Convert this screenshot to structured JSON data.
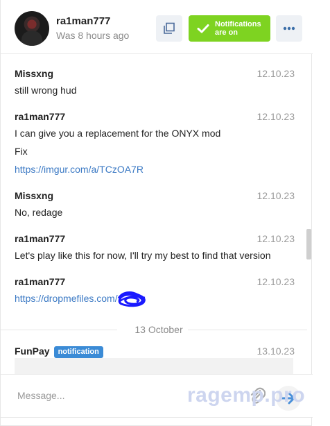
{
  "header": {
    "username": "ra1man777",
    "last_seen": "Was 8 hours ago",
    "notifications_label": "Notifications are on"
  },
  "messages": [
    {
      "author": "Missxng",
      "date": "12.10.23",
      "lines": [
        "still wrong hud"
      ]
    },
    {
      "author": "ra1man777",
      "date": "12.10.23",
      "lines": [
        "I can give you a replacement for the ONYX mod",
        "Fix"
      ],
      "link": "https://imgur.com/a/TCzOA7R"
    },
    {
      "author": "Missxng",
      "date": "12.10.23",
      "lines": [
        "No, redage"
      ]
    },
    {
      "author": "ra1man777",
      "date": "12.10.23",
      "lines": [
        "Let's play like this for now, I'll try my best to find that version"
      ]
    },
    {
      "author": "ra1man777",
      "date": "12.10.23",
      "link": "https://dropmefiles.com/"
    }
  ],
  "day_separator": "13 October",
  "notification_message": {
    "author": "FunPay",
    "badge": "notification",
    "date": "13.10.23"
  },
  "composer": {
    "placeholder": "Message..."
  },
  "watermark": "ragemp.pro",
  "colors": {
    "accent_green": "#7ed321",
    "link_blue": "#3b79c4",
    "badge_blue": "#3b8bd6",
    "send_blue": "#4a90d9"
  }
}
